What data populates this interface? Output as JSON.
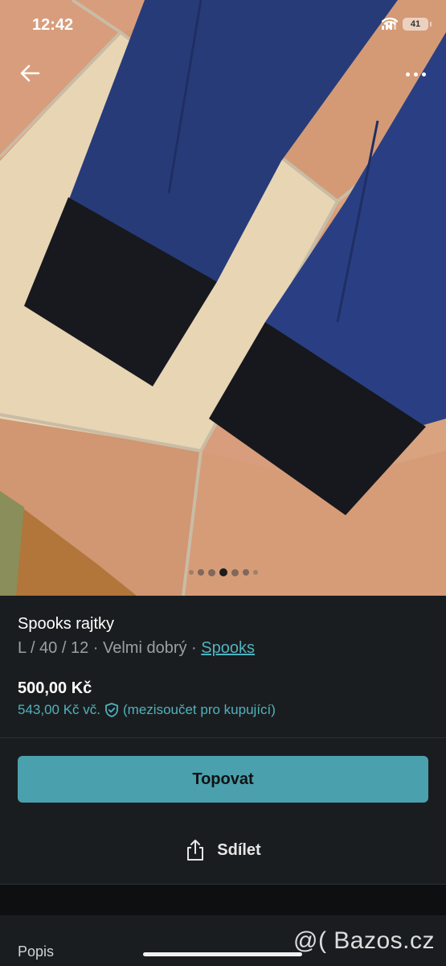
{
  "status": {
    "time": "12:42",
    "battery": "41"
  },
  "listing": {
    "title": "Spooks rajtky",
    "details": "L / 40 / 12 · Velmi dobrý · ",
    "brand": "Spooks",
    "price": "500,00 Kč",
    "price_with_fee": "543,00 Kč vč.",
    "price_note": "(mezisoučet pro kupující)"
  },
  "actions": {
    "promote_label": "Topovat",
    "share_label": "Sdílet"
  },
  "sections": {
    "description_label": "Popis"
  },
  "watermark": "@( Bazos.cz",
  "gallery": {
    "total_images": 7,
    "current_index": 3
  },
  "colors": {
    "accent": "#4fb3bf",
    "button": "#4aa0ac",
    "background": "#1a1d1f"
  },
  "icons": {
    "back": "arrow-left-icon",
    "more": "more-horizontal-icon",
    "shield": "shield-check-icon",
    "share": "share-icon"
  }
}
